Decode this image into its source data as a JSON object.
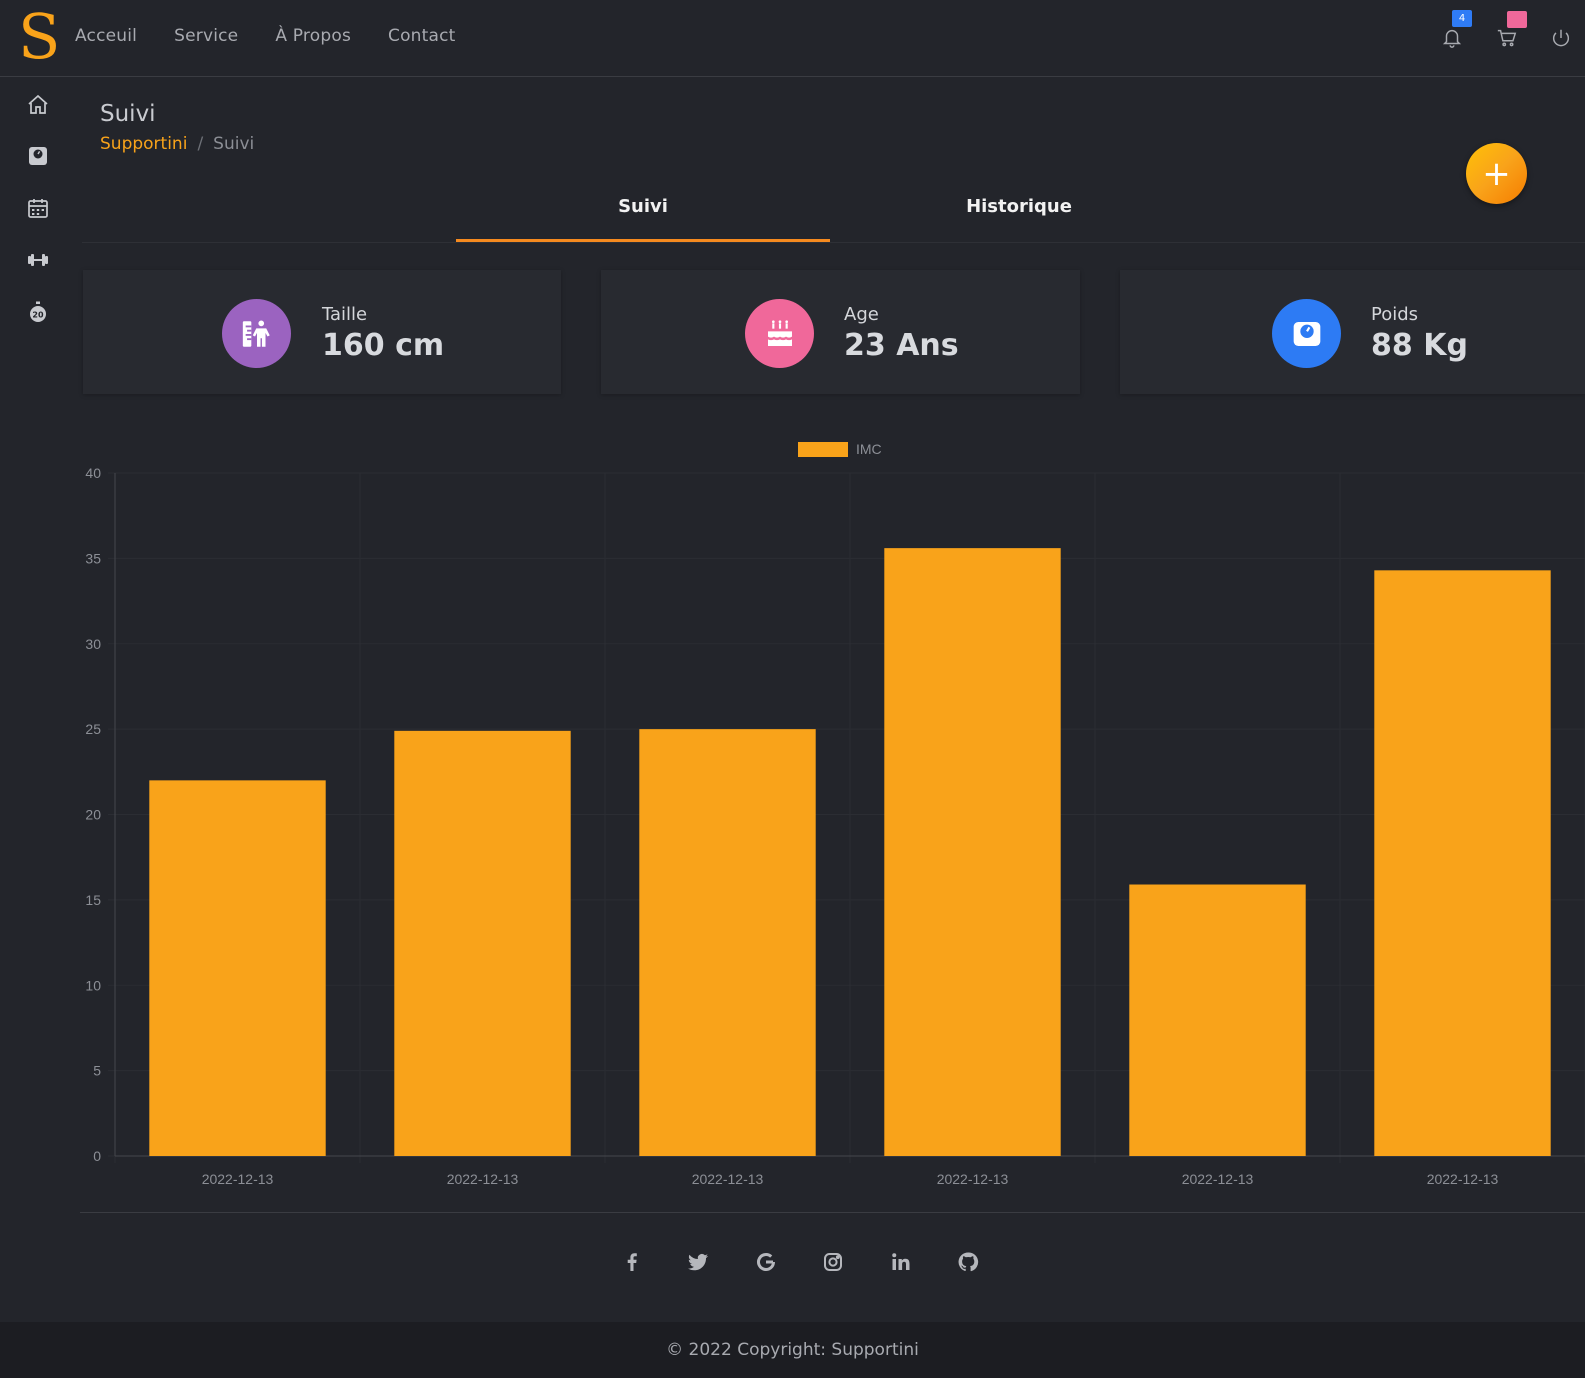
{
  "brand": {
    "logo": "S"
  },
  "nav": {
    "items": [
      "Acceuil",
      "Service",
      "À Propos",
      "Contact"
    ]
  },
  "header": {
    "notifications_count": "4"
  },
  "page": {
    "title": "Suivi"
  },
  "breadcrumb": {
    "root": "Supportini",
    "separator": "/",
    "current": "Suivi"
  },
  "fab": {
    "label": "+"
  },
  "tabs": [
    {
      "label": "Suivi",
      "active": true
    },
    {
      "label": "Historique",
      "active": false
    }
  ],
  "stats": [
    {
      "label": "Taille",
      "value": "160 cm",
      "color": "#9b63c0",
      "icon": "person-height-icon"
    },
    {
      "label": "Age",
      "value": "23 Ans",
      "color": "#f0689a",
      "icon": "birthday-cake-icon"
    },
    {
      "label": "Poids",
      "value": "88 Kg",
      "color": "#2d7bf4",
      "icon": "weight-scale-icon"
    }
  ],
  "chart_data": {
    "type": "bar",
    "categories": [
      "2022-12-13",
      "2022-12-13",
      "2022-12-13",
      "2022-12-13",
      "2022-12-13",
      "2022-12-13"
    ],
    "series": [
      {
        "name": "IMC",
        "values": [
          22,
          24.9,
          25,
          35.6,
          15.9,
          34.3
        ],
        "color": "#f9a31a"
      }
    ],
    "ylim": [
      0,
      40
    ],
    "yticks": [
      0,
      5,
      10,
      15,
      20,
      25,
      30,
      35,
      40
    ],
    "legend": "top-center",
    "grid": true
  },
  "footer": {
    "socials": [
      "facebook-icon",
      "twitter-icon",
      "google-icon",
      "instagram-icon",
      "linkedin-icon",
      "github-icon"
    ],
    "copyright": "© 2022 Copyright: Supportini"
  }
}
